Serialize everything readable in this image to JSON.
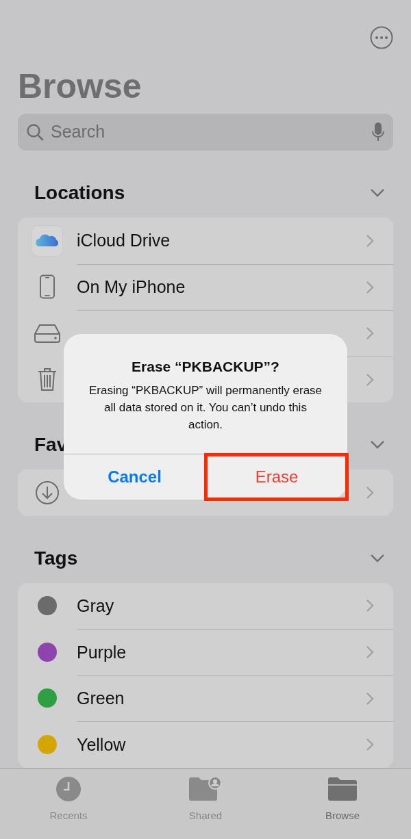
{
  "header": {
    "title": "Browse"
  },
  "search": {
    "placeholder": "Search"
  },
  "sections": [
    {
      "title": "Locations",
      "items": [
        {
          "kind": "icloud",
          "label": "iCloud Drive"
        },
        {
          "kind": "phone",
          "label": "On My iPhone"
        },
        {
          "kind": "drive"
        },
        {
          "kind": "trash"
        }
      ]
    },
    {
      "title": "Fav",
      "items": [
        {
          "kind": "download"
        }
      ]
    },
    {
      "title": "Tags",
      "items": [
        {
          "kind": "tag",
          "label": "Gray",
          "color": "#6b6b6e"
        },
        {
          "kind": "tag",
          "label": "Purple",
          "color": "#8e44ad"
        },
        {
          "kind": "tag",
          "label": "Green",
          "color": "#2ea043"
        },
        {
          "kind": "tag",
          "label": "Yellow",
          "color": "#d4a700"
        }
      ]
    }
  ],
  "dialog": {
    "title": "Erase “PKBACKUP”?",
    "message": "Erasing “PKBACKUP” will permanently erase all data stored on it. You can’t undo this action.",
    "buttons": [
      {
        "kind": "cancel",
        "label": "Cancel",
        "highlighted": false
      },
      {
        "kind": "destructive",
        "label": "Erase",
        "highlighted": true
      }
    ]
  },
  "tab_bar": [
    {
      "kind": "recents",
      "label": "Recents",
      "selected": false
    },
    {
      "kind": "shared",
      "label": "Shared",
      "selected": false
    },
    {
      "kind": "browse",
      "label": "Browse",
      "selected": true
    }
  ]
}
